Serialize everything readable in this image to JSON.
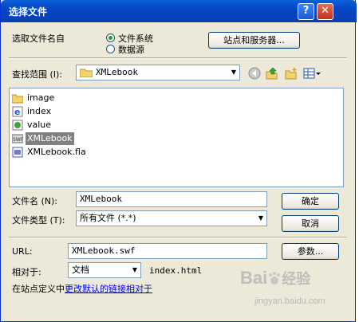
{
  "dialog": {
    "title": "选择文件",
    "help_glyph": "?",
    "close_glyph": "✕"
  },
  "source": {
    "label": "选取文件名自",
    "options": [
      {
        "label": "文件系统",
        "selected": true
      },
      {
        "label": "数据源",
        "selected": false
      }
    ],
    "sites_button": "站点和服务器..."
  },
  "lookin": {
    "label": "查找范围 (I):",
    "value": "XMLebook"
  },
  "files": [
    {
      "name": "image",
      "icon": "folder-icon",
      "selected": false
    },
    {
      "name": "index",
      "icon": "ie-html-icon",
      "selected": false
    },
    {
      "name": "value",
      "icon": "script-file-icon",
      "selected": false
    },
    {
      "name": "XMLebook",
      "icon": "swf-file-icon",
      "selected": true
    },
    {
      "name": "XMLebook.fla",
      "icon": "fla-file-icon",
      "selected": false
    }
  ],
  "filename": {
    "label": "文件名 (N):",
    "value": "XMLebook",
    "ok_button": "确定"
  },
  "filetype": {
    "label": "文件类型 (T):",
    "value": "所有文件 (*.*)",
    "cancel_button": "取消"
  },
  "url": {
    "label": "URL:",
    "value": "XMLebook.swf",
    "params_button": "参数..."
  },
  "relative": {
    "label": "相对于:",
    "value": "文档",
    "file": "index.html"
  },
  "footer": {
    "prefix": "在站点定义中",
    "link": "更改默认的链接相对于"
  },
  "watermark": {
    "brand": "Bai",
    "brand_suffix": "经验",
    "site": "jingyan.baidu.com"
  }
}
